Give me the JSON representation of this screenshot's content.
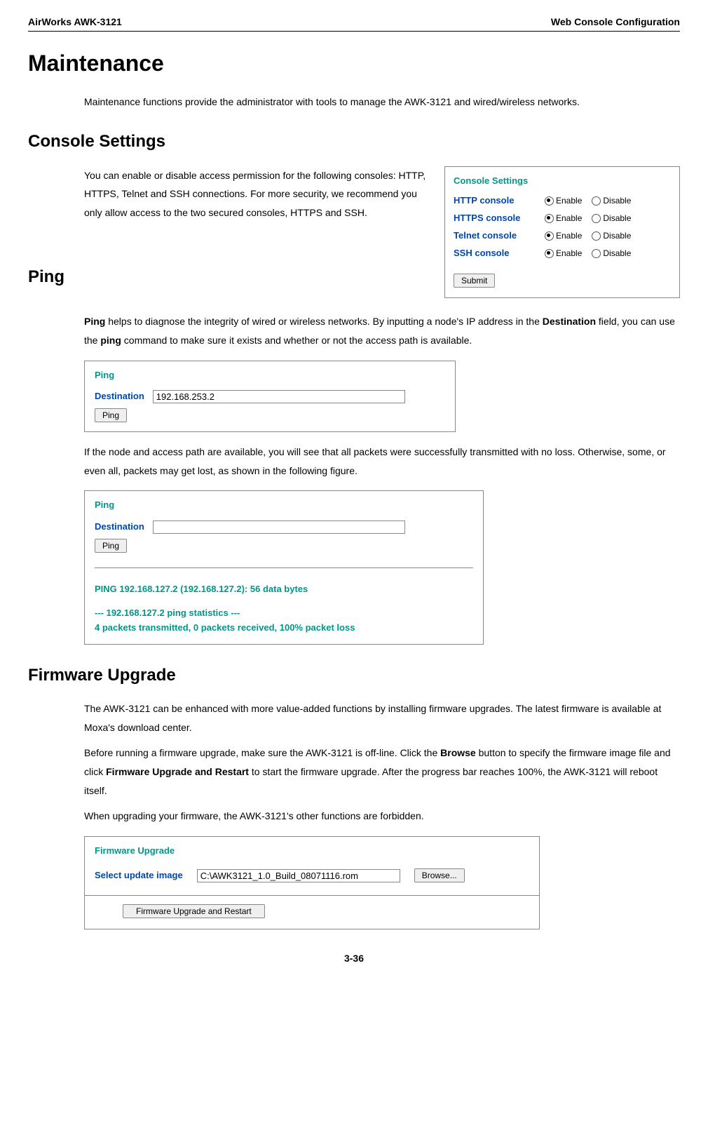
{
  "header": {
    "left": "AirWorks AWK-3121",
    "right": "Web Console Configuration"
  },
  "h1": "Maintenance",
  "intro": "Maintenance functions provide the administrator with tools to manage the AWK-3121 and wired/wireless networks.",
  "h2_console": "Console Settings",
  "console_p": "You can enable or disable access permission for the following consoles: HTTP, HTTPS, Telnet and SSH connections. For more security, we recommend you only allow access to the two secured consoles, HTTPS and SSH.",
  "console_box": {
    "title": "Console Settings",
    "rows": [
      {
        "label": "HTTP console",
        "opt1": "Enable",
        "opt2": "Disable"
      },
      {
        "label": "HTTPS console",
        "opt1": "Enable",
        "opt2": "Disable"
      },
      {
        "label": "Telnet console",
        "opt1": "Enable",
        "opt2": "Disable"
      },
      {
        "label": "SSH console",
        "opt1": "Enable",
        "opt2": "Disable"
      }
    ],
    "submit": "Submit"
  },
  "h2_ping": "Ping",
  "ping_p1a": "Ping",
  "ping_p1b": " helps to diagnose the integrity of wired or wireless networks. By inputting a node's IP address in the ",
  "ping_p1c": "Destination",
  "ping_p1d": " field, you can use the ",
  "ping_p1e": "ping",
  "ping_p1f": " command to make sure it exists and whether or not the access path is available.",
  "ping_panel1": {
    "title": "Ping",
    "dest": "Destination",
    "value": "192.168.253.2",
    "btn": "Ping"
  },
  "ping_p2": "If the node and access path are available, you will see that all packets were successfully transmitted with no loss. Otherwise, some, or even all, packets may get lost, as shown in the following figure.",
  "ping_panel2": {
    "title": "Ping",
    "dest": "Destination",
    "value": "",
    "btn": "Ping",
    "out1": "PING 192.168.127.2 (192.168.127.2): 56 data bytes",
    "out2": "--- 192.168.127.2 ping statistics ---",
    "out3": "4 packets transmitted, 0 packets received, 100% packet loss"
  },
  "h2_fw": "Firmware Upgrade",
  "fw_p1": "The AWK-3121 can be enhanced with more value-added functions by installing firmware upgrades. The latest firmware is available at Moxa's download center.",
  "fw_p2a": "Before running a firmware upgrade, make sure the AWK-3121 is off-line. Click the ",
  "fw_p2b": "Browse",
  "fw_p2c": " button to specify the firmware image file and click ",
  "fw_p2d": "Firmware Upgrade and Restart",
  "fw_p2e": " to start the firmware upgrade. After the progress bar reaches 100%, the AWK-3121 will reboot itself.",
  "fw_p3": "When upgrading your firmware, the AWK-3121's other functions are forbidden.",
  "fw_panel": {
    "title": "Firmware Upgrade",
    "label": "Select update image",
    "value": "C:\\AWK3121_1.0_Build_08071116.rom",
    "browse": "Browse...",
    "action": "Firmware Upgrade and Restart"
  },
  "footer": "3-36"
}
